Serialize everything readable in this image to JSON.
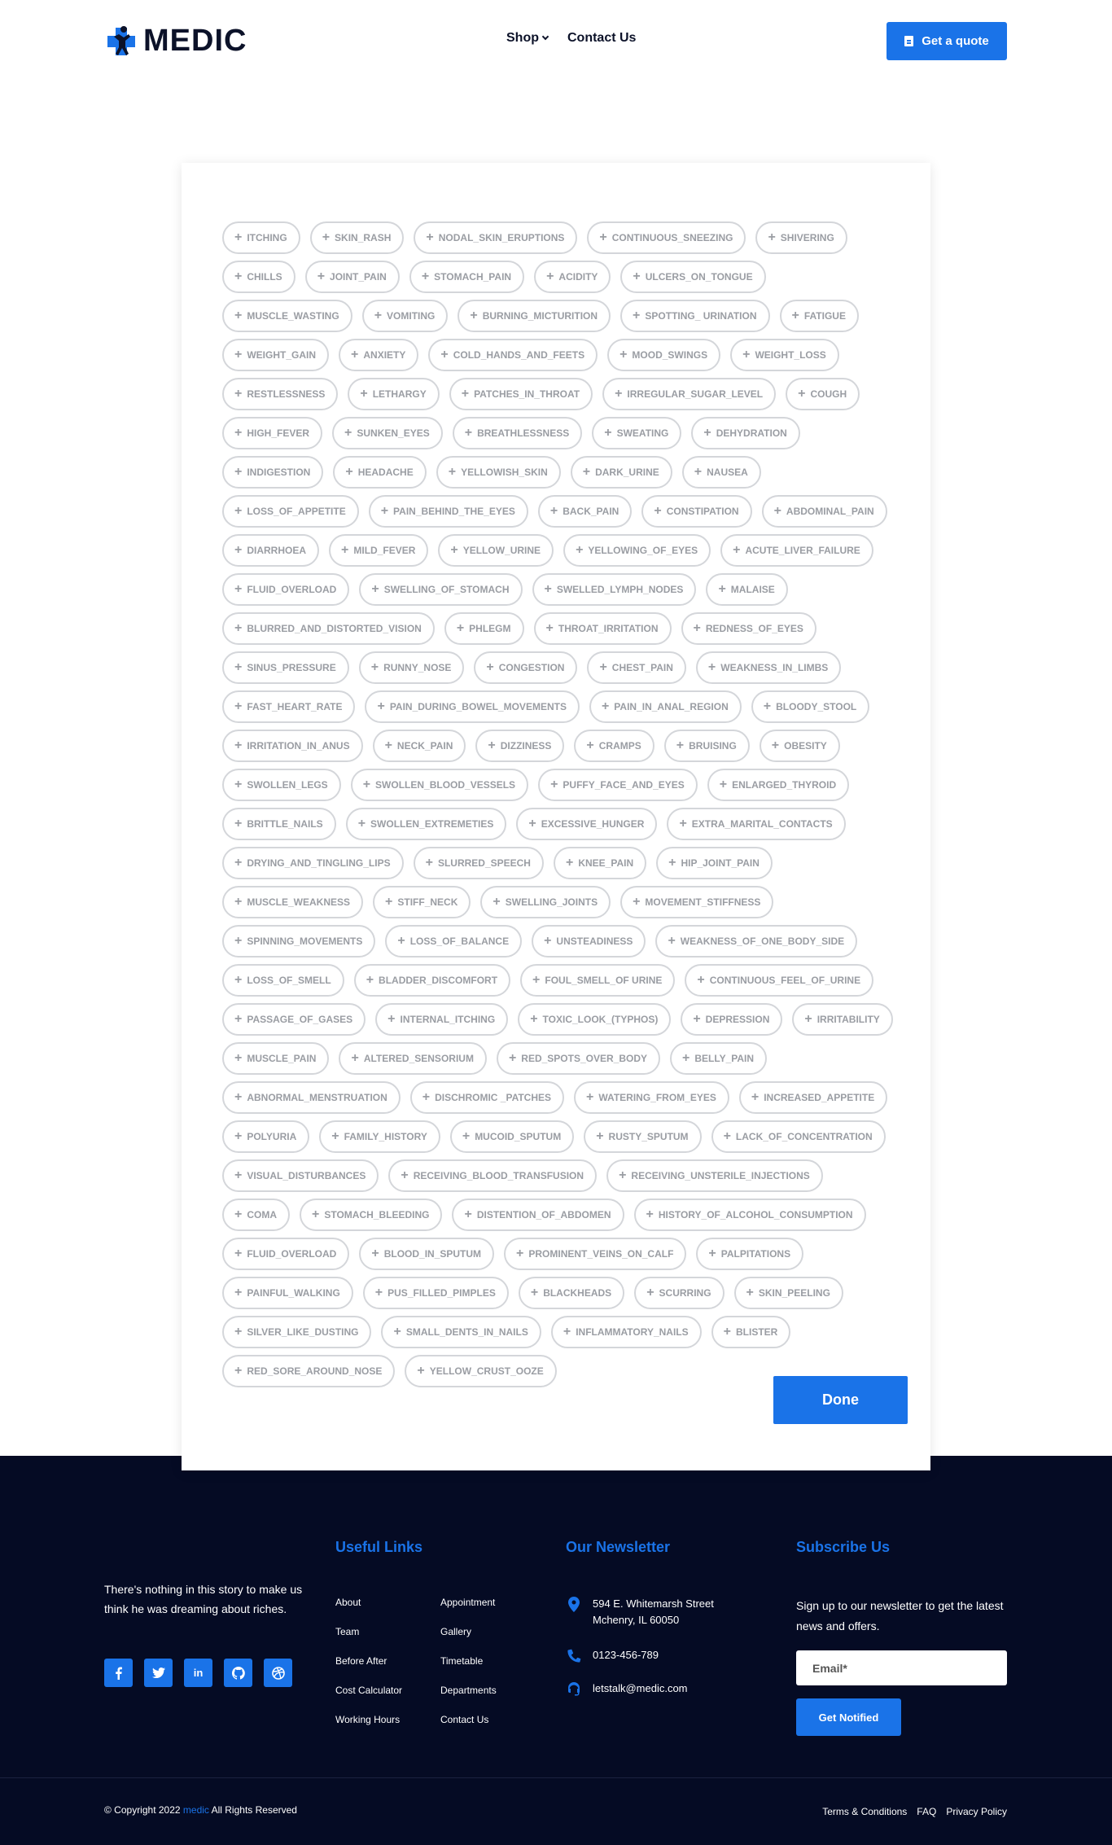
{
  "header": {
    "logo_text": "MEDIC",
    "nav": [
      {
        "label": "Shop",
        "has_dropdown": true
      },
      {
        "label": "Contact Us",
        "has_dropdown": false
      }
    ],
    "cta_label": "Get a quote"
  },
  "symptoms": [
    "ITCHING",
    "SKIN_RASH",
    "NODAL_SKIN_ERUPTIONS",
    "CONTINUOUS_SNEEZING",
    "SHIVERING",
    "CHILLS",
    "JOINT_PAIN",
    "STOMACH_PAIN",
    "ACIDITY",
    "ULCERS_ON_TONGUE",
    "MUSCLE_WASTING",
    "VOMITING",
    "BURNING_MICTURITION",
    "SPOTTING_ URINATION",
    "FATIGUE",
    "WEIGHT_GAIN",
    "ANXIETY",
    "COLD_HANDS_AND_FEETS",
    "MOOD_SWINGS",
    "WEIGHT_LOSS",
    "RESTLESSNESS",
    "LETHARGY",
    "PATCHES_IN_THROAT",
    "IRREGULAR_SUGAR_LEVEL",
    "COUGH",
    "HIGH_FEVER",
    "SUNKEN_EYES",
    "BREATHLESSNESS",
    "SWEATING",
    "DEHYDRATION",
    "INDIGESTION",
    "HEADACHE",
    "YELLOWISH_SKIN",
    "DARK_URINE",
    "NAUSEA",
    "LOSS_OF_APPETITE",
    "PAIN_BEHIND_THE_EYES",
    "BACK_PAIN",
    "CONSTIPATION",
    "ABDOMINAL_PAIN",
    "DIARRHOEA",
    "MILD_FEVER",
    "YELLOW_URINE",
    "YELLOWING_OF_EYES",
    "ACUTE_LIVER_FAILURE",
    "FLUID_OVERLOAD",
    "SWELLING_OF_STOMACH",
    "SWELLED_LYMPH_NODES",
    "MALAISE",
    "BLURRED_AND_DISTORTED_VISION",
    "PHLEGM",
    "THROAT_IRRITATION",
    "REDNESS_OF_EYES",
    "SINUS_PRESSURE",
    "RUNNY_NOSE",
    "CONGESTION",
    "CHEST_PAIN",
    "WEAKNESS_IN_LIMBS",
    "FAST_HEART_RATE",
    "PAIN_DURING_BOWEL_MOVEMENTS",
    "PAIN_IN_ANAL_REGION",
    "BLOODY_STOOL",
    "IRRITATION_IN_ANUS",
    "NECK_PAIN",
    "DIZZINESS",
    "CRAMPS",
    "BRUISING",
    "OBESITY",
    "SWOLLEN_LEGS",
    "SWOLLEN_BLOOD_VESSELS",
    "PUFFY_FACE_AND_EYES",
    "ENLARGED_THYROID",
    "BRITTLE_NAILS",
    "SWOLLEN_EXTREMETIES",
    "EXCESSIVE_HUNGER",
    "EXTRA_MARITAL_CONTACTS",
    "DRYING_AND_TINGLING_LIPS",
    "SLURRED_SPEECH",
    "KNEE_PAIN",
    "HIP_JOINT_PAIN",
    "MUSCLE_WEAKNESS",
    "STIFF_NECK",
    "SWELLING_JOINTS",
    "MOVEMENT_STIFFNESS",
    "SPINNING_MOVEMENTS",
    "LOSS_OF_BALANCE",
    "UNSTEADINESS",
    "WEAKNESS_OF_ONE_BODY_SIDE",
    "LOSS_OF_SMELL",
    "BLADDER_DISCOMFORT",
    "FOUL_SMELL_OF URINE",
    "CONTINUOUS_FEEL_OF_URINE",
    "PASSAGE_OF_GASES",
    "INTERNAL_ITCHING",
    "TOXIC_LOOK_(TYPHOS)",
    "DEPRESSION",
    "IRRITABILITY",
    "MUSCLE_PAIN",
    "ALTERED_SENSORIUM",
    "RED_SPOTS_OVER_BODY",
    "BELLY_PAIN",
    "ABNORMAL_MENSTRUATION",
    "DISCHROMIC _PATCHES",
    "WATERING_FROM_EYES",
    "INCREASED_APPETITE",
    "POLYURIA",
    "FAMILY_HISTORY",
    "MUCOID_SPUTUM",
    "RUSTY_SPUTUM",
    "LACK_OF_CONCENTRATION",
    "VISUAL_DISTURBANCES",
    "RECEIVING_BLOOD_TRANSFUSION",
    "RECEIVING_UNSTERILE_INJECTIONS",
    "COMA",
    "STOMACH_BLEEDING",
    "DISTENTION_OF_ABDOMEN",
    "HISTORY_OF_ALCOHOL_CONSUMPTION",
    "FLUID_OVERLOAD",
    "BLOOD_IN_SPUTUM",
    "PROMINENT_VEINS_ON_CALF",
    "PALPITATIONS",
    "PAINFUL_WALKING",
    "PUS_FILLED_PIMPLES",
    "BLACKHEADS",
    "SCURRING",
    "SKIN_PEELING",
    "SILVER_LIKE_DUSTING",
    "SMALL_DENTS_IN_NAILS",
    "INFLAMMATORY_NAILS",
    "BLISTER",
    "RED_SORE_AROUND_NOSE",
    "YELLOW_CRUST_OOZE"
  ],
  "done_label": "Done",
  "footer": {
    "tagline": "There's nothing in this story to make us think he was dreaming about riches.",
    "socials": [
      {
        "icon": "facebook-icon",
        "glyph": "f"
      },
      {
        "icon": "twitter-icon",
        "glyph": ""
      },
      {
        "icon": "linkedin-icon",
        "glyph": "in"
      },
      {
        "icon": "github-icon",
        "glyph": ""
      },
      {
        "icon": "dribbble-icon",
        "glyph": ""
      }
    ],
    "useful_links_title": "Useful Links",
    "links_col1": [
      "About",
      "Team",
      "Before After",
      "Cost Calculator",
      "Working Hours"
    ],
    "links_col2": [
      "Appointment",
      "Gallery",
      "Timetable",
      "Departments",
      "Contact Us"
    ],
    "newsletter_title": "Our Newsletter",
    "address_line1": "594 E. Whitemarsh Street",
    "address_line2": "Mchenry, IL 60050",
    "phone": "0123-456-789",
    "email": "letstalk@medic.com",
    "subscribe_title": "Subscribe Us",
    "subscribe_text": "Sign up to our newsletter to get the latest news and offers.",
    "email_placeholder": "Email*",
    "notify_label": "Get Notified",
    "copyright_prefix": "© Copyright 2022",
    "copyright_brand": "medic",
    "copyright_suffix": "All Rights Reserved",
    "legal_links": [
      "Terms & Conditions",
      "FAQ",
      "Privacy Policy"
    ]
  },
  "colors": {
    "accent": "#1a73e8",
    "navy": "#0c1229",
    "footer_bg": "#050b24",
    "chip_border": "#d4d6da",
    "chip_text": "#9a9da3"
  }
}
